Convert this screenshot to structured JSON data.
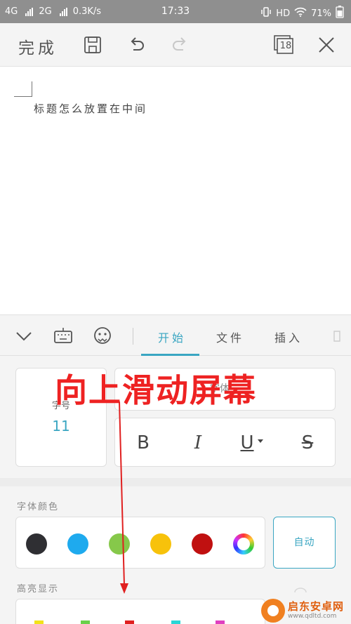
{
  "status_bar": {
    "network1": "4G",
    "network2": "2G",
    "speed": "0.3K/s",
    "time": "17:33",
    "hd": "HD",
    "battery": "71%"
  },
  "toolbar": {
    "done_label": "完成",
    "page_count": "18"
  },
  "document": {
    "text": "标题怎么放置在中间"
  },
  "panel": {
    "tabs": [
      "开始",
      "文件",
      "插入"
    ],
    "active_tab": "开始",
    "font_size_label": "字号",
    "font_size_value": "11",
    "font_name_partial": "字体",
    "format_buttons": [
      "B",
      "I",
      "U",
      "S"
    ],
    "font_color_label": "字体颜色",
    "font_colors": [
      "#2f2f33",
      "#1eaaee",
      "#86c84a",
      "#f7c20b",
      "#c01010",
      "rainbow"
    ],
    "auto_label": "自动",
    "highlight_label": "高亮显示",
    "highlight_colors": [
      "#f2e21a",
      "#6ad04a",
      "#e02020",
      "#29d6d6",
      "#e040c0"
    ]
  },
  "annotation": {
    "text": "向上滑动屏幕",
    "color": "#ee2222"
  },
  "watermark": {
    "name": "启东安卓网",
    "url": "www.qdltd.com"
  }
}
